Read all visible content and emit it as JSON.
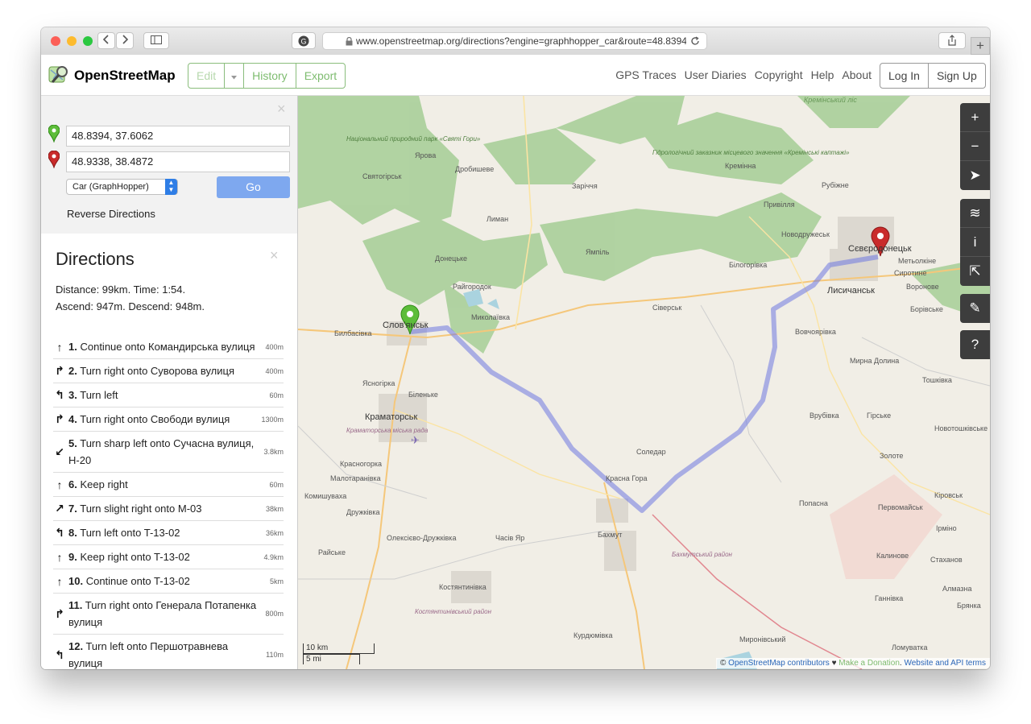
{
  "browser": {
    "url": "www.openstreetmap.org/directions?engine=graphhopper_car&route=48.8394%"
  },
  "header": {
    "site_name": "OpenStreetMap",
    "edit_label": "Edit",
    "history_label": "History",
    "export_label": "Export",
    "nav": [
      "GPS Traces",
      "User Diaries",
      "Copyright",
      "Help",
      "About"
    ],
    "login_label": "Log In",
    "signup_label": "Sign Up"
  },
  "route_form": {
    "from_value": "48.8394, 37.6062",
    "to_value": "48.9338, 38.4872",
    "engine": "Car (GraphHopper)",
    "go_label": "Go",
    "reverse_label": "Reverse Directions"
  },
  "directions": {
    "title": "Directions",
    "summary_1": "Distance: 99km. Time: 1:54.",
    "summary_2": "Ascend: 947m. Descend: 948m.",
    "steps": [
      {
        "num": "1.",
        "text": "Continue onto Командирська вулиця",
        "dist": "400m",
        "icon": "straight-arrow-icon"
      },
      {
        "num": "2.",
        "text": "Turn right onto Суворова вулиця",
        "dist": "400m",
        "icon": "turn-right-icon"
      },
      {
        "num": "3.",
        "text": "Turn left",
        "dist": "60m",
        "icon": "turn-left-icon"
      },
      {
        "num": "4.",
        "text": "Turn right onto Свободи вулиця",
        "dist": "1300m",
        "icon": "turn-right-icon"
      },
      {
        "num": "5.",
        "text": "Turn sharp left onto Сучасна вулиця, Н-20",
        "dist": "3.8km",
        "icon": "sharp-left-icon"
      },
      {
        "num": "6.",
        "text": "Keep right",
        "dist": "60m",
        "icon": "straight-arrow-icon"
      },
      {
        "num": "7.",
        "text": "Turn slight right onto M-03",
        "dist": "38km",
        "icon": "slight-right-icon"
      },
      {
        "num": "8.",
        "text": "Turn left onto T-13-02",
        "dist": "36km",
        "icon": "turn-left-icon"
      },
      {
        "num": "9.",
        "text": "Keep right onto T-13-02",
        "dist": "4.9km",
        "icon": "straight-arrow-icon"
      },
      {
        "num": "10.",
        "text": "Continue onto T-13-02",
        "dist": "5km",
        "icon": "straight-arrow-icon"
      },
      {
        "num": "11.",
        "text": "Turn right onto Генерала Потапенка вулиця",
        "dist": "800m",
        "icon": "turn-right-icon"
      },
      {
        "num": "12.",
        "text": "Turn left onto Першотравнева вулиця",
        "dist": "110m",
        "icon": "turn-left-icon"
      }
    ]
  },
  "map": {
    "labels": [
      "Кремінський ліс",
      "Національний природний парк «Святі Гори»",
      "Ярова",
      "Дробишеве",
      "Святогірськ",
      "Заріччя",
      "Гідрологічний заказник місцевого значення «Кремінські каптажі»",
      "Кремінна",
      "Рубіжне",
      "Лиман",
      "Привілля",
      "Новодружеськ",
      "Сєвєродонецьк",
      "Метьолкіне",
      "Сиротине",
      "Ямпіль",
      "Донецьке",
      "Білогорівка",
      "Лисичанськ",
      "Воронове",
      "Райгородок",
      "Сіверськ",
      "Борівське",
      "Слов'янськ",
      "Миколаївка",
      "Билбасівка",
      "Вовчоярівка",
      "Ясногірка",
      "Мирна Долина",
      "Біленьке",
      "Тошківка",
      "Краматорськ",
      "Краматорська міська рада",
      "Врубівка",
      "Гірське",
      "Новотошківське",
      "Соледар",
      "Золоте",
      "Красногорка",
      "Красна Гора",
      "Малотаранівка",
      "Комишуваха",
      "Попасна",
      "Первомайськ",
      "Кіровськ",
      "Дружківка",
      "Часів Яр",
      "Бахмут",
      "Ірміно",
      "Олексієво-Дружківка",
      "Бахмутський район",
      "Райське",
      "Калинове",
      "Стаханов",
      "Костянтинівка",
      "Алмазна",
      "Костянтинівський район",
      "Ганнівка",
      "Брянка",
      "Курдюмівка",
      "Миронівський",
      "Ломуватка"
    ],
    "scale_km": "10 km",
    "scale_mi": "5 mi",
    "controls": [
      "zoom-in-icon",
      "zoom-out-icon",
      "locate-icon",
      "layers-icon",
      "info-icon",
      "share-icon",
      "note-icon",
      "query-icon"
    ],
    "attribution": {
      "prefix": "©",
      "contributors": "OpenStreetMap contributors",
      "heart": "♥",
      "donation": "Make a Donation",
      "terms": "Website and API terms"
    }
  }
}
